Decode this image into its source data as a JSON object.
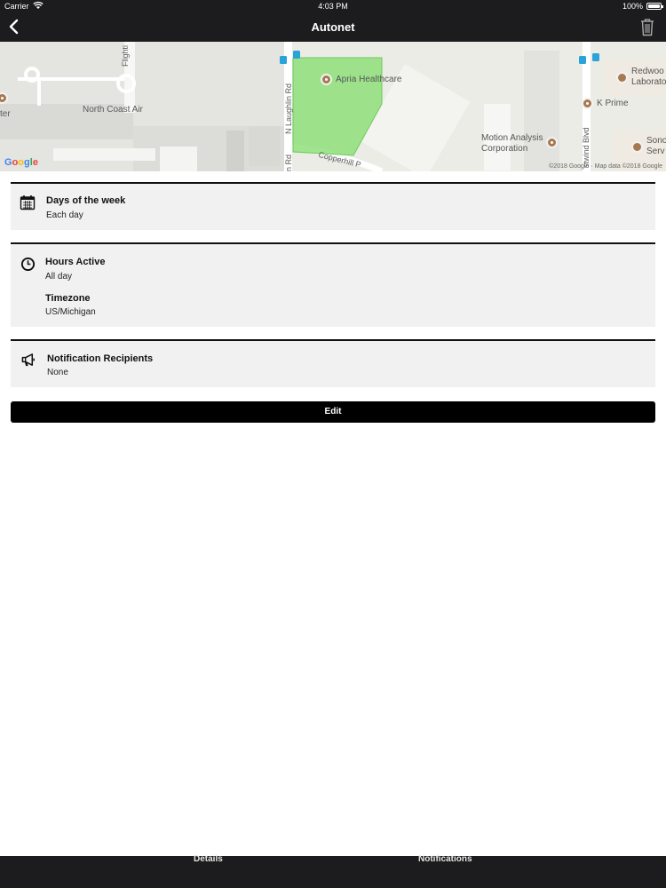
{
  "status_bar": {
    "carrier": "Carrier",
    "time": "4:03 PM",
    "battery": "100%"
  },
  "nav": {
    "title": "Autonet",
    "back_icon": "chevron-left-icon",
    "delete_icon": "trash-icon"
  },
  "map": {
    "labels": {
      "flighti": "Flighti",
      "north_coast_air": "North Coast Air",
      "ter": "ter",
      "n_laughlin": "N Laughlin Rd",
      "n_rd": "n Rd",
      "copperhill": "Copperhill P",
      "stwind": "stwind Blvd"
    },
    "pois": {
      "apria": "Apria Healthcare",
      "k_prime": "K Prime",
      "motion_1": "Motion Analysis",
      "motion_2": "Corporation",
      "redwood_1": "Redwoo",
      "redwood_2": "Laborato",
      "sono_1": "Sono",
      "sono_2": "Serv"
    },
    "google": [
      "G",
      "o",
      "o",
      "g",
      "l",
      "e"
    ],
    "attribution": "©2018 Google · Map data ©2018 Google",
    "geofence_color": "#8fe07a"
  },
  "schedule": {
    "days": {
      "icon": "calendar-icon",
      "label": "Days of the week",
      "value": "Each day"
    },
    "hours": {
      "icon": "clock-icon",
      "label": "Hours Active",
      "value": "All day",
      "timezone_label": "Timezone",
      "timezone_value": "US/Michigan"
    },
    "recipients": {
      "icon": "megaphone-icon",
      "label": "Notification Recipients",
      "value": "None"
    }
  },
  "edit_label": "Edit",
  "tabs": {
    "details": "Details",
    "notifications": "Notifications"
  }
}
